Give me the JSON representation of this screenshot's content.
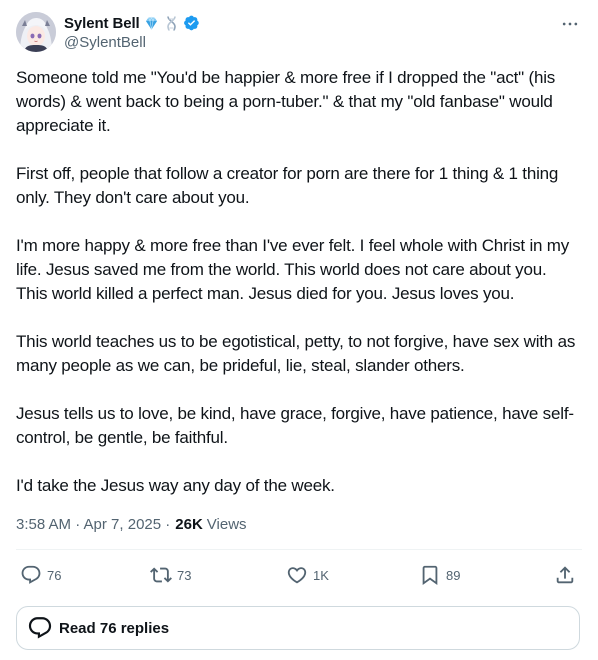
{
  "author": {
    "display_name": "Sylent Bell",
    "handle": "@SylentBell",
    "badge_emojis": [
      "gem-icon",
      "dna-icon"
    ],
    "verified": true,
    "verified_color": "#1d9bf0"
  },
  "tweet": {
    "paragraphs": [
      "Someone told me \"You'd be happier & more free if I dropped the \"act\" (his words) & went back to being a porn-tuber.\" & that my \"old fanbase\" would appreciate it.",
      "First off, people that follow a creator for porn are there for 1 thing & 1 thing only. They don't care about you.",
      "I'm more happy & more free than I've ever felt. I feel whole with Christ in my life. Jesus saved me from the world. This world does not care about you. This world killed a perfect man. Jesus died for you. Jesus loves you.",
      "This world teaches us to be egotistical, petty, to not forgive, have sex with as many people as we can, be prideful, lie, steal, slander others.",
      "Jesus tells us to love, be kind, have grace, forgive, have patience, have self-control, be gentle, be faithful.",
      "I'd take the Jesus way any day of the week."
    ],
    "timestamp": "3:58 AM · Apr 7, 2025 ·",
    "views_count": "26K",
    "views_label": "Views"
  },
  "actions": {
    "replies": "76",
    "reposts": "73",
    "likes": "1K",
    "bookmarks": "89"
  },
  "read_replies_label": "Read 76 replies",
  "colors": {
    "text_primary": "#0f1419",
    "text_secondary": "#536471",
    "border": "#cfd9de",
    "divider": "#eff3f4"
  }
}
